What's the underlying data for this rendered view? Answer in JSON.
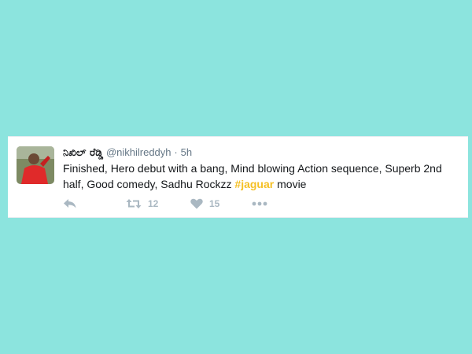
{
  "tweet": {
    "display_name": "ನಿಖಿಲ್ ರೆಡ್ಡಿ",
    "handle": "@nikhilreddyh",
    "separator": "·",
    "time": "5h",
    "text_before": "Finished, Hero debut with a bang, Mind blowing Action sequence, Superb 2nd half, Good comedy, Sadhu Rockzz ",
    "hashtag": "#jaguar",
    "text_after": " movie"
  },
  "actions": {
    "retweet_count": "12",
    "like_count": "15"
  },
  "colors": {
    "background": "#8ce4de",
    "hashtag": "#f5c024",
    "icon": "#aab8c2"
  },
  "icons": [
    "reply-icon",
    "retweet-icon",
    "heart-icon",
    "more-icon"
  ]
}
